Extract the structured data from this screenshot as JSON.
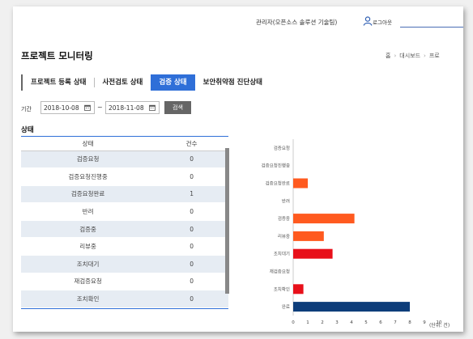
{
  "header": {
    "user_text": "관리자(오픈소스 솔루션 기술팀)",
    "logout_label": "로그아웃"
  },
  "page": {
    "title": "프로젝트 모니터링",
    "breadcrumb": [
      "홈",
      "대시보드",
      "프로"
    ]
  },
  "tabs": [
    {
      "label": "프로젝트 등록 상태",
      "active": false
    },
    {
      "label": "사전검토 상태",
      "active": false
    },
    {
      "label": "검증 상태",
      "active": true
    },
    {
      "label": "보안취약점 진단상태",
      "active": false
    }
  ],
  "filter": {
    "label": "기간",
    "start_date": "2018-10-08",
    "separator": "~",
    "end_date": "2018-11-08",
    "search_label": "검색"
  },
  "section": {
    "title": "상태"
  },
  "table": {
    "headers": [
      "상태",
      "건수"
    ],
    "rows": [
      {
        "status": "검증요청",
        "count": "0"
      },
      {
        "status": "검증요청진행중",
        "count": "0"
      },
      {
        "status": "검증요청완료",
        "count": "1"
      },
      {
        "status": "반려",
        "count": "0"
      },
      {
        "status": "검증중",
        "count": "0"
      },
      {
        "status": "리뷰중",
        "count": "0"
      },
      {
        "status": "조치대기",
        "count": "0"
      },
      {
        "status": "재검증요청",
        "count": "0"
      },
      {
        "status": "조치확인",
        "count": "0"
      }
    ]
  },
  "chart_data": {
    "type": "bar",
    "orientation": "horizontal",
    "categories": [
      "검증요청",
      "검증요청진행중",
      "검증요청완료",
      "반려",
      "검증중",
      "리뷰중",
      "조치대기",
      "재검증요청",
      "조치확인",
      "완료"
    ],
    "values": [
      0,
      0,
      1,
      0,
      4.2,
      2.1,
      2.7,
      0,
      0.7,
      8
    ],
    "colors": [
      "#ff5a1f",
      "#ff5a1f",
      "#ff5a1f",
      "#ff5a1f",
      "#ff5a1f",
      "#ff5a1f",
      "#e8101a",
      "#e8101a",
      "#e8101a",
      "#0d3d7a"
    ],
    "xlim": [
      0,
      10
    ],
    "xticks": [
      "0",
      "1",
      "2",
      "3",
      "4",
      "5",
      "6",
      "7",
      "8",
      "9",
      "10"
    ],
    "unit_label": "(단위: 건)",
    "grid": false
  }
}
